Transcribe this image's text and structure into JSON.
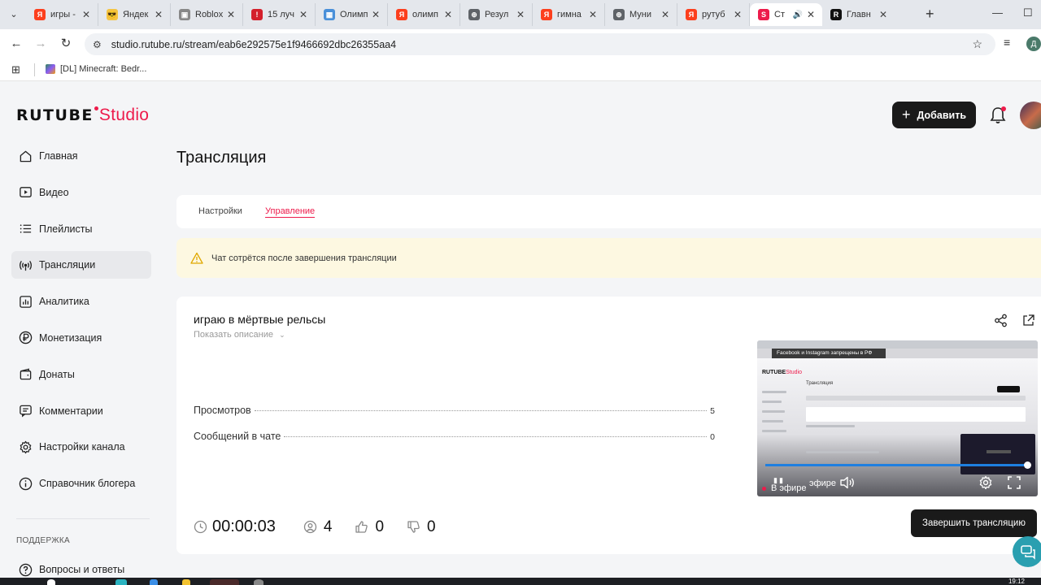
{
  "browser": {
    "tabs": [
      {
        "title": "игры -",
        "fav": "Я",
        "color": "#fc3f1d",
        "active": false
      },
      {
        "title": "Яндек",
        "fav": "😎",
        "color": "#f5c542",
        "active": false
      },
      {
        "title": "Roblox",
        "fav": "▣",
        "color": "#888888",
        "active": false
      },
      {
        "title": "15 луч",
        "fav": "!",
        "color": "#d4202c",
        "active": false
      },
      {
        "title": "Олимп",
        "fav": "▦",
        "color": "#4a90d9",
        "active": false
      },
      {
        "title": "олимп",
        "fav": "Я",
        "color": "#fc3f1d",
        "active": false
      },
      {
        "title": "Резул",
        "fav": "⊕",
        "color": "#5f6368",
        "active": false
      },
      {
        "title": "гимна",
        "fav": "Я",
        "color": "#fc3f1d",
        "active": false
      },
      {
        "title": "Муни",
        "fav": "⊕",
        "color": "#5f6368",
        "active": false
      },
      {
        "title": "рутуб",
        "fav": "Я",
        "color": "#fc3f1d",
        "active": false
      },
      {
        "title": "Ст",
        "fav": "S",
        "color": "#ed1b4b",
        "active": true
      },
      {
        "title": "Главн",
        "fav": "R",
        "color": "#111111",
        "active": false
      }
    ],
    "url": "studio.rutube.ru/stream/eab6e292575e1f9466692dbc26355aa4",
    "bookmark": "[DL] Minecraft: Bedr...",
    "profile_initial": "Д"
  },
  "header": {
    "logo_main": "RUTUBE",
    "logo_sub": "Studio",
    "add_label": "Добавить"
  },
  "sidebar": {
    "items": [
      {
        "label": "Главная",
        "icon": "home-icon",
        "active": false
      },
      {
        "label": "Видео",
        "icon": "video-icon",
        "active": false
      },
      {
        "label": "Плейлисты",
        "icon": "playlist-icon",
        "active": false
      },
      {
        "label": "Трансляции",
        "icon": "broadcast-icon",
        "active": true
      },
      {
        "label": "Аналитика",
        "icon": "analytics-icon",
        "active": false
      },
      {
        "label": "Монетизация",
        "icon": "ruble-icon",
        "active": false
      },
      {
        "label": "Донаты",
        "icon": "wallet-icon",
        "active": false
      },
      {
        "label": "Комментарии",
        "icon": "comment-icon",
        "active": false
      },
      {
        "label": "Настройки канала",
        "icon": "gear-icon",
        "active": false
      },
      {
        "label": "Справочник блогера",
        "icon": "info-icon",
        "active": false
      }
    ],
    "support_heading": "ПОДДЕРЖКА",
    "faq_label": "Вопросы и ответы"
  },
  "main": {
    "title": "Трансляция",
    "tabs": [
      {
        "label": "Настройки",
        "active": false
      },
      {
        "label": "Управление",
        "active": true
      }
    ],
    "warning": "Чат сотрётся после завершения трансляции",
    "stream": {
      "title": "играю в мёртвые рельсы",
      "show_description": "Показать описание",
      "stats": [
        {
          "label": "Просмотров",
          "value": "5"
        },
        {
          "label": "Сообщений в чате",
          "value": "0"
        }
      ],
      "timer": "00:00:03",
      "viewers": "4",
      "likes": "0",
      "dislikes": "0"
    },
    "preview": {
      "banner": "Facebook и Instagram запрещены в РФ",
      "live_label": "В эфире",
      "live_label_2": "эфире",
      "progress": 0.99
    },
    "end_button": "Завершить трансляцию"
  },
  "taskbar": {
    "time": "19:12"
  },
  "colors": {
    "accent": "#ed1b4b",
    "dark_button": "#1a1a1a",
    "warning_bg": "#fdf8e1"
  }
}
